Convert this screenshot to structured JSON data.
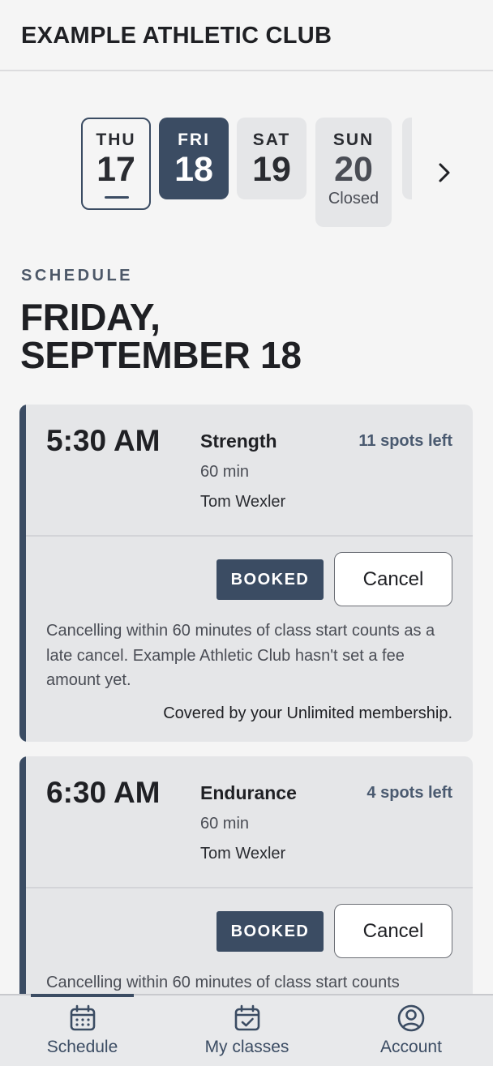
{
  "header": {
    "title": "EXAMPLE ATHLETIC CLUB"
  },
  "date_strip": {
    "days": [
      {
        "dow": "THU",
        "day": "17",
        "note": "",
        "state": "today"
      },
      {
        "dow": "FRI",
        "day": "18",
        "note": "",
        "state": "selected"
      },
      {
        "dow": "SAT",
        "day": "19",
        "note": "",
        "state": "normal"
      },
      {
        "dow": "SUN",
        "day": "20",
        "note": "Closed",
        "state": "closed"
      }
    ],
    "next_icon": "chevron-right-icon"
  },
  "schedule": {
    "section_label": "SCHEDULE",
    "title_line1": "FRIDAY,",
    "title_line2": "SEPTEMBER 18",
    "classes": [
      {
        "time": "5:30 AM",
        "name": "Strength",
        "spots": "11 spots left",
        "duration": "60 min",
        "instructor": "Tom Wexler",
        "badge": "BOOKED",
        "cancel_label": "Cancel",
        "policy": "Cancelling within 60 minutes of class start counts as a late cancel. Example Athletic Club hasn't set a fee amount yet.",
        "coverage": "Covered by your Unlimited membership."
      },
      {
        "time": "6:30 AM",
        "name": "Endurance",
        "spots": "4 spots left",
        "duration": "60 min",
        "instructor": "Tom Wexler",
        "badge": "BOOKED",
        "cancel_label": "Cancel",
        "policy": "Cancelling within 60 minutes of class start counts",
        "coverage": ""
      }
    ]
  },
  "tabbar": {
    "tabs": [
      {
        "label": "Schedule",
        "icon": "calendar-icon",
        "active": true
      },
      {
        "label": "My classes",
        "icon": "calendar-check-icon",
        "active": false
      },
      {
        "label": "Account",
        "icon": "user-circle-icon",
        "active": false
      }
    ]
  },
  "colors": {
    "accent": "#3b4c63",
    "background": "#f5f5f5",
    "card": "#e5e6e8"
  }
}
